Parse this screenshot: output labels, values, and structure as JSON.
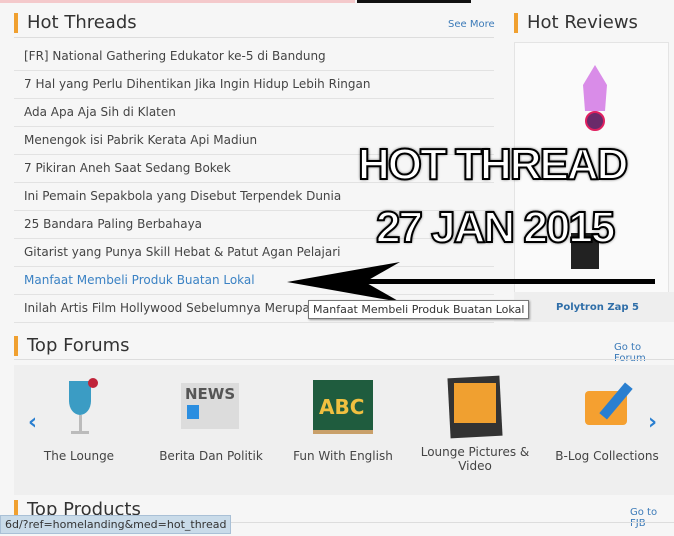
{
  "hot_threads": {
    "title": "Hot Threads",
    "see_more": "See More",
    "items": [
      "[FR] National Gathering Edukator ke-5 di Bandung",
      "7 Hal yang Perlu Dihentikan Jika Ingin Hidup Lebih Ringan",
      "Ada Apa Aja Sih di Klaten",
      "Menengok isi Pabrik Kerata Api Madiun",
      "7 Pikiran Aneh Saat Sedang Bokek",
      "Ini Pemain Sepakbola yang Disebut Terpendek Dunia",
      "25 Bandara Paling Berbahaya",
      "Gitarist yang Punya Skill Hebat & Patut Agan Pelajari",
      "Manfaat Membeli Produk Buatan Lokal",
      "Inilah Artis Film Hollywood Sebelumnya Merupakan"
    ]
  },
  "hot_reviews": {
    "title": "Hot Reviews",
    "product_name": "Polytron Zap 5"
  },
  "top_forums": {
    "title": "Top Forums",
    "link": "Go to Forum",
    "items": [
      "The Lounge",
      "Berita Dan Politik",
      "Fun With English",
      "Lounge Pictures & Video",
      "B-Log Collections"
    ],
    "news_icon_text": "NEWS",
    "abc_icon_text": "ABC"
  },
  "top_products": {
    "title": "Top Products",
    "link": "Go to FJB"
  },
  "overlay": {
    "line1": "HOT THREAD",
    "line2": "27 JAN 2015"
  },
  "tooltip": "Manfaat Membeli Produk Buatan Lokal",
  "status_bar": "6d/?ref=homelanding&med=hot_thread",
  "colors": {
    "accent": "#f0a030",
    "link": "#3b82c4"
  }
}
